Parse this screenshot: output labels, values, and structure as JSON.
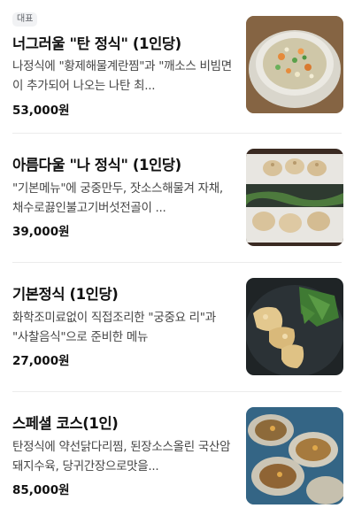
{
  "menu": {
    "items": [
      {
        "badge": "대표",
        "name": "너그러울 \"탄 정식\" (1인당)",
        "description": "나정식에 \"황제해물계란찜\"과 \"깨소스 비빔면이 추가되어 나오는 나탄 최...",
        "price": "53,000원",
        "image_icon": "soup-bowl-photo"
      },
      {
        "name": "아름다울 \"나 정식\" (1인당)",
        "description": "\"기본메뉴\"에 궁중만두, 잣소스해물겨 자채, 채수로끓인불고기버섯전골이 ...",
        "price": "39,000원",
        "image_icon": "dumplings-photo"
      },
      {
        "name": "기본정식 (1인당)",
        "description": "화학조미료없이 직접조리한 \"궁중요 리\"과 \"사찰음식\"으로 준비한 메뉴",
        "price": "27,000원",
        "image_icon": "fried-dish-photo"
      },
      {
        "name": "스페셜 코스(1인)",
        "description": "탄정식에 약선닭다리찜, 된장소스올린 국산암돼지수육, 당귀간장으로맛을...",
        "price": "85,000원",
        "image_icon": "shellfish-photo"
      }
    ]
  }
}
